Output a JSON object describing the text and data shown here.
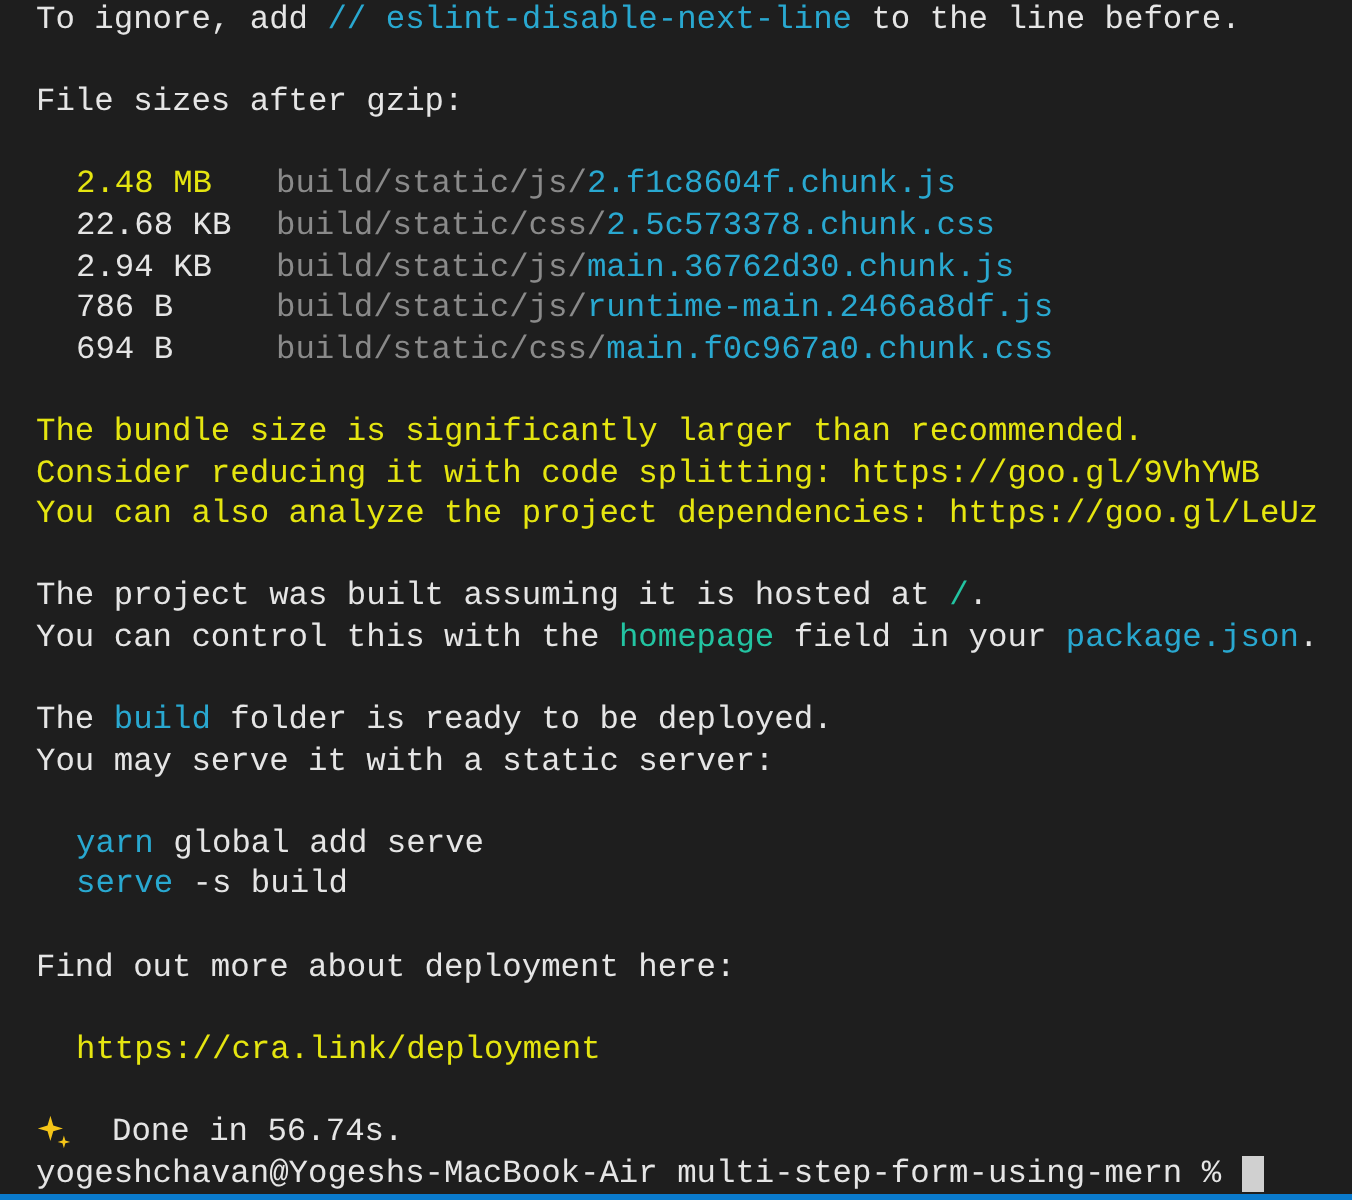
{
  "terminal": {
    "blocks": [
      {
        "kind": "text",
        "lines": [
          {
            "segments": [
              {
                "text": "To ignore, add ",
                "kind": "plain"
              },
              {
                "text": "// eslint-disable-next-line",
                "kind": "cyan"
              },
              {
                "text": " to the line before.",
                "kind": "plain"
              }
            ]
          }
        ]
      },
      {
        "kind": "text",
        "lines": [
          {
            "segments": [
              {
                "text": "File sizes after gzip:",
                "kind": "plain"
              }
            ]
          }
        ]
      },
      {
        "kind": "files",
        "files": [
          {
            "size": "2.48 MB",
            "oversized": true,
            "dir": "build/static/js/",
            "name": "2.f1c8604f.chunk.js"
          },
          {
            "size": "22.68 KB",
            "oversized": false,
            "dir": "build/static/css/",
            "name": "2.5c573378.chunk.css"
          },
          {
            "size": "2.94 KB",
            "oversized": false,
            "dir": "build/static/js/",
            "name": "main.36762d30.chunk.js"
          },
          {
            "size": "786 B",
            "oversized": false,
            "dir": "build/static/js/",
            "name": "runtime-main.2466a8df.js"
          },
          {
            "size": "694 B",
            "oversized": false,
            "dir": "build/static/css/",
            "name": "main.f0c967a0.chunk.css"
          }
        ]
      },
      {
        "kind": "text",
        "lines": [
          {
            "segments": [
              {
                "text": "The bundle size is significantly larger than recommended.",
                "kind": "warn"
              }
            ]
          },
          {
            "segments": [
              {
                "text": "Consider reducing it with code splitting: https://goo.gl/9VhYWB",
                "kind": "warn"
              }
            ]
          },
          {
            "segments": [
              {
                "text": "You can also analyze the project dependencies: https://goo.gl/LeUz",
                "kind": "warn"
              }
            ]
          }
        ]
      },
      {
        "kind": "text",
        "lines": [
          {
            "segments": [
              {
                "text": "The project was built assuming it is hosted at ",
                "kind": "plain"
              },
              {
                "text": "/",
                "kind": "green"
              },
              {
                "text": ".",
                "kind": "plain"
              }
            ]
          },
          {
            "segments": [
              {
                "text": "You can control this with the ",
                "kind": "plain"
              },
              {
                "text": "homepage",
                "kind": "green"
              },
              {
                "text": " field in your ",
                "kind": "plain"
              },
              {
                "text": "package.json",
                "kind": "cyan"
              },
              {
                "text": ".",
                "kind": "plain"
              }
            ]
          }
        ]
      },
      {
        "kind": "text",
        "lines": [
          {
            "segments": [
              {
                "text": "The ",
                "kind": "plain"
              },
              {
                "text": "build",
                "kind": "cyan"
              },
              {
                "text": " folder is ready to be deployed.",
                "kind": "plain"
              }
            ]
          },
          {
            "segments": [
              {
                "text": "You may serve it with a static server:",
                "kind": "plain"
              }
            ]
          }
        ]
      },
      {
        "kind": "indented",
        "lines": [
          {
            "segments": [
              {
                "text": "yarn",
                "kind": "cyan"
              },
              {
                "text": " global add serve",
                "kind": "plain"
              }
            ]
          },
          {
            "segments": [
              {
                "text": "serve",
                "kind": "cyan"
              },
              {
                "text": " -s build",
                "kind": "plain"
              }
            ]
          }
        ]
      },
      {
        "kind": "text",
        "lines": [
          {
            "segments": [
              {
                "text": "Find out more about deployment here:",
                "kind": "plain"
              }
            ]
          }
        ]
      },
      {
        "kind": "indented",
        "lines": [
          {
            "segments": [
              {
                "text": "https://cra.link/deployment",
                "kind": "warn"
              }
            ]
          }
        ]
      },
      {
        "kind": "done",
        "text": "Done in 56.74s."
      }
    ],
    "prompt": "yogeshchavan@Yogeshs-MacBook-Air multi-step-form-using-mern %"
  }
}
